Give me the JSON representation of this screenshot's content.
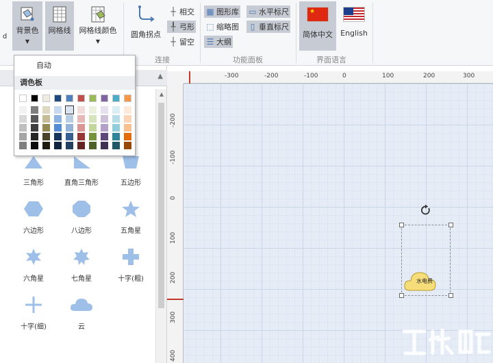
{
  "ribbon": {
    "bg_color_label": "背景色",
    "grid_label": "网格线",
    "grid_color_label": "网格线颜色",
    "corner_point_label": "圆角拐点",
    "intersect_label": "相交",
    "arc_label": "弓形",
    "gap_label": "留空",
    "connect_group": "连接",
    "shape_lib_label": "图形库",
    "thumbnail_label": "缩略图",
    "outline_label": "大纲",
    "h_ruler_label": "水平标尺",
    "v_ruler_label": "垂直标尺",
    "panel_group": "功能面板",
    "zh_label": "简体中文",
    "en_label": "English",
    "lang_group": "界面语言"
  },
  "dropdown": {
    "auto_label": "自动",
    "palette_label": "调色板",
    "top_row": [
      "#ffffff",
      "#000000",
      "#eeece1",
      "#1f497d",
      "#4f81bd",
      "#c0504d",
      "#9bbb59",
      "#8064a2",
      "#4bacc6",
      "#f79646"
    ],
    "columns": [
      [
        "#f2f2f2",
        "#d8d8d8",
        "#bfbfbf",
        "#a5a5a5",
        "#7f7f7f"
      ],
      [
        "#7f7f7f",
        "#595959",
        "#3f3f3f",
        "#262626",
        "#0c0c0c"
      ],
      [
        "#ddd9c3",
        "#c4bd97",
        "#938953",
        "#494429",
        "#1d1b10"
      ],
      [
        "#c6d9f0",
        "#8db3e2",
        "#548dd4",
        "#17365d",
        "#0f243e"
      ],
      [
        "#dbe5f1",
        "#b8cce4",
        "#95b3d7",
        "#366092",
        "#244061"
      ],
      [
        "#f2dcdb",
        "#e5b9b7",
        "#d99694",
        "#953734",
        "#632423"
      ],
      [
        "#ebf1dd",
        "#d7e3bc",
        "#c3d69b",
        "#76923c",
        "#4f6128"
      ],
      [
        "#e5e0ec",
        "#ccc1d9",
        "#b2a2c7",
        "#5f497a",
        "#3f3151"
      ],
      [
        "#dbeef3",
        "#b7dde8",
        "#92cddc",
        "#31859b",
        "#205867"
      ],
      [
        "#fdeada",
        "#fbd5b5",
        "#fac08f",
        "#e36c09",
        "#974806"
      ]
    ]
  },
  "shapes": [
    {
      "label": "三角形",
      "icon": "triangle-icon"
    },
    {
      "label": "直角三角形",
      "icon": "right-triangle-icon"
    },
    {
      "label": "五边形",
      "icon": "pentagon-icon"
    },
    {
      "label": "六边形",
      "icon": "hexagon-icon"
    },
    {
      "label": "八边形",
      "icon": "octagon-icon"
    },
    {
      "label": "五角星",
      "icon": "five-star-icon"
    },
    {
      "label": "六角星",
      "icon": "six-star-icon"
    },
    {
      "label": "七角星",
      "icon": "seven-star-icon"
    },
    {
      "label": "十字(粗)",
      "icon": "thick-cross-icon"
    },
    {
      "label": "十字(细)",
      "icon": "thin-cross-icon"
    },
    {
      "label": "云",
      "icon": "cloud-icon"
    }
  ],
  "ruler": {
    "top": [
      "-300",
      "-200",
      "-100",
      "0",
      "100",
      "200",
      "300"
    ],
    "left": [
      "-200",
      "-100",
      "0",
      "100",
      "200",
      "300",
      "400"
    ]
  },
  "canvas": {
    "cloud_text": "水电费"
  },
  "colors": {
    "shape_fill": "#9ec0e8",
    "cloud_fill": "#f6dd7a",
    "canvas_bg": "#e6ecf6"
  }
}
